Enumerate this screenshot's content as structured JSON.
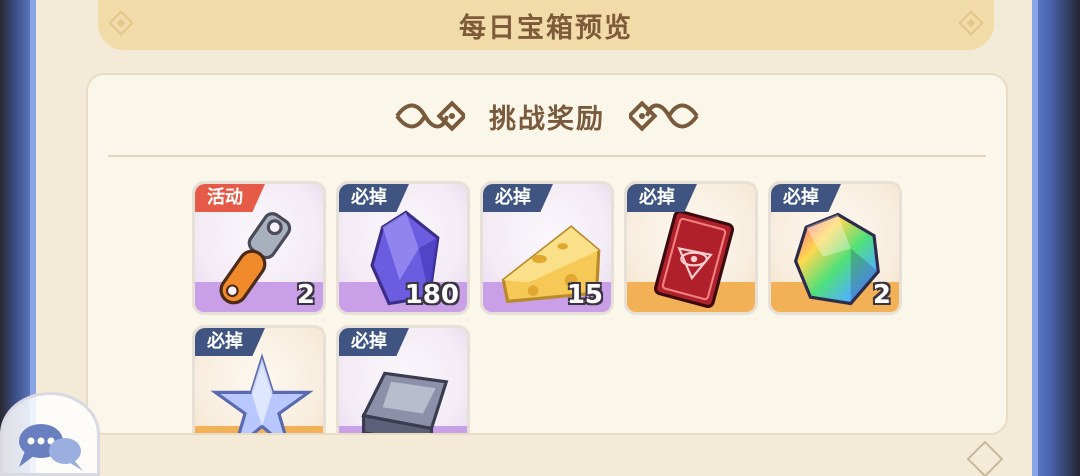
{
  "header": {
    "title": "每日宝箱预览"
  },
  "section": {
    "title": "挑战奖励"
  },
  "items": [
    {
      "tag": "活动",
      "tag_color": "red",
      "rarity": "purple",
      "icon": "bottle-opener-icon",
      "qty": "2"
    },
    {
      "tag": "必掉",
      "tag_color": "blue",
      "rarity": "purple",
      "icon": "purple-crystal-icon",
      "qty": "180"
    },
    {
      "tag": "必掉",
      "tag_color": "blue",
      "rarity": "purple",
      "icon": "cheese-icon",
      "qty": "15"
    },
    {
      "tag": "必掉",
      "tag_color": "blue",
      "rarity": "orange",
      "icon": "eye-card-icon",
      "qty": ""
    },
    {
      "tag": "必掉",
      "tag_color": "blue",
      "rarity": "orange",
      "icon": "rainbow-gem-icon",
      "qty": "2"
    },
    {
      "tag": "必掉",
      "tag_color": "blue",
      "rarity": "orange",
      "icon": "star-crystal-icon",
      "qty": ""
    },
    {
      "tag": "必掉",
      "tag_color": "blue",
      "rarity": "purple",
      "icon": "metal-ingot-icon",
      "qty": ""
    }
  ],
  "colors": {
    "frame_blue": "#6f8fd8",
    "title_bar": "#f1dba8",
    "tag_red": "#e65a48",
    "tag_blue": "#3f5480",
    "purple_rarity": "#c99fe8",
    "orange_rarity": "#f2b157"
  }
}
